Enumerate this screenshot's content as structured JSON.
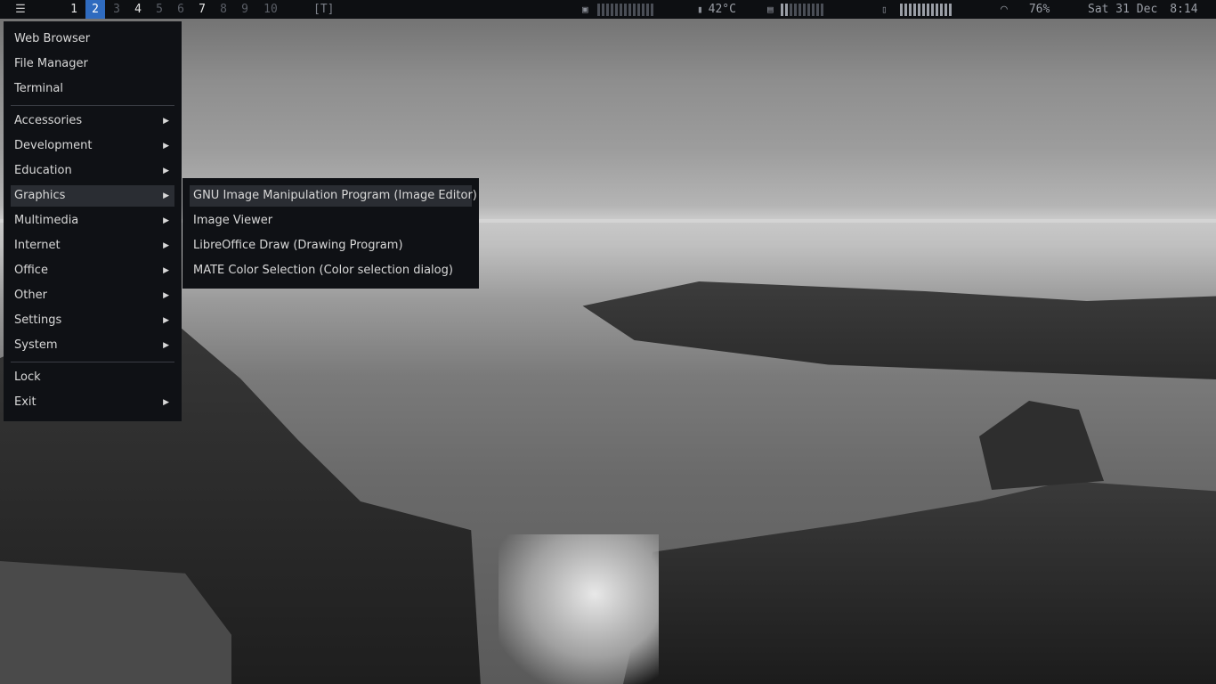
{
  "topbar": {
    "menu_icon": "☰",
    "workspaces": [
      {
        "label": "1",
        "state": "occupied"
      },
      {
        "label": "2",
        "state": "active"
      },
      {
        "label": "3",
        "state": "empty"
      },
      {
        "label": "4",
        "state": "occupied"
      },
      {
        "label": "5",
        "state": "empty"
      },
      {
        "label": "6",
        "state": "empty"
      },
      {
        "label": "7",
        "state": "occupied"
      },
      {
        "label": "8",
        "state": "empty"
      },
      {
        "label": "9",
        "state": "empty"
      },
      {
        "label": "10",
        "state": "empty"
      }
    ],
    "layout_indicator": "[T]",
    "cpu_icon": "cpu-icon",
    "temp_icon": "thermometer-icon",
    "temperature": "42°C",
    "memory_icon": "memory-icon",
    "battery_icon": "battery-icon",
    "wifi_icon": "wifi-icon",
    "wifi_strength": "76%",
    "date": "Sat 31 Dec",
    "time": "8:14",
    "accent_color": "#2f6bbf"
  },
  "main_menu": {
    "quick_items": [
      "Web Browser",
      "File Manager",
      "Terminal"
    ],
    "categories": [
      "Accessories",
      "Development",
      "Education",
      "Graphics",
      "Multimedia",
      "Internet",
      "Office",
      "Other",
      "Settings",
      "System"
    ],
    "selected_category": "Graphics",
    "session_items": [
      "Lock",
      "Exit"
    ],
    "submenu_arrow": "▶"
  },
  "graphics_submenu": {
    "items": [
      "GNU Image Manipulation Program (Image Editor)",
      "Image Viewer",
      "LibreOffice Draw (Drawing Program)",
      "MATE Color Selection (Color selection dialog)"
    ],
    "selected_item": "GNU Image Manipulation Program (Image Editor)"
  }
}
